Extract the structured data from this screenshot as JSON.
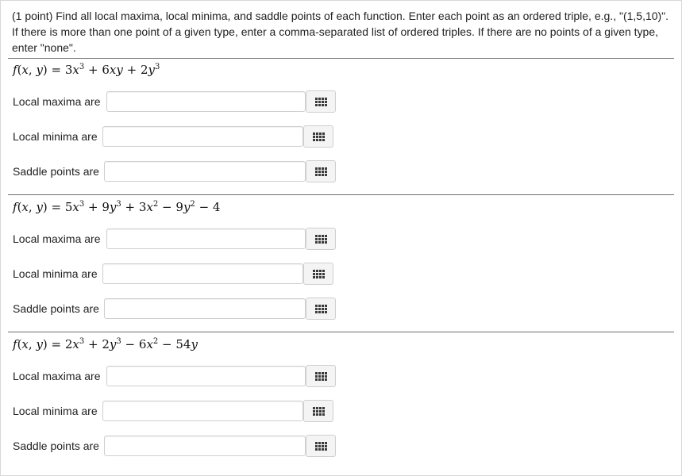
{
  "intro": {
    "line1": "(1 point) Find all local maxima, local minima, and saddle points of each function. Enter each point as an ordered triple, e.g., \"(1,5,10)\".",
    "line2": "If there is more than one point of a given type, enter a comma-separated list of ordered triples. If there are no points of a given type,",
    "line3": "enter \"none\"."
  },
  "parts": [
    {
      "function_text": "f(x,y) = 3x^3 + 6xy + 2y^3",
      "rows": [
        {
          "label": "Local maxima are",
          "value": "",
          "icon": "grid-icon"
        },
        {
          "label": "Local minima are",
          "value": "",
          "icon": "grid-icon"
        },
        {
          "label": "Saddle points are",
          "value": "",
          "icon": "grid-icon"
        }
      ]
    },
    {
      "function_text": "f(x,y) = 5x^3 + 9y^3 + 3x^2 - 9y^2 - 4",
      "rows": [
        {
          "label": "Local maxima are",
          "value": "",
          "icon": "grid-icon"
        },
        {
          "label": "Local minima are",
          "value": "",
          "icon": "grid-icon"
        },
        {
          "label": "Saddle points are",
          "value": "",
          "icon": "grid-icon"
        }
      ]
    },
    {
      "function_text": "f(x,y) = 2x^3 + 2y^3 - 6x^2 - 54y",
      "rows": [
        {
          "label": "Local maxima are",
          "value": "",
          "icon": "grid-icon"
        },
        {
          "label": "Local minima are",
          "value": "",
          "icon": "grid-icon"
        },
        {
          "label": "Saddle points are",
          "value": "",
          "icon": "grid-icon"
        }
      ]
    }
  ]
}
